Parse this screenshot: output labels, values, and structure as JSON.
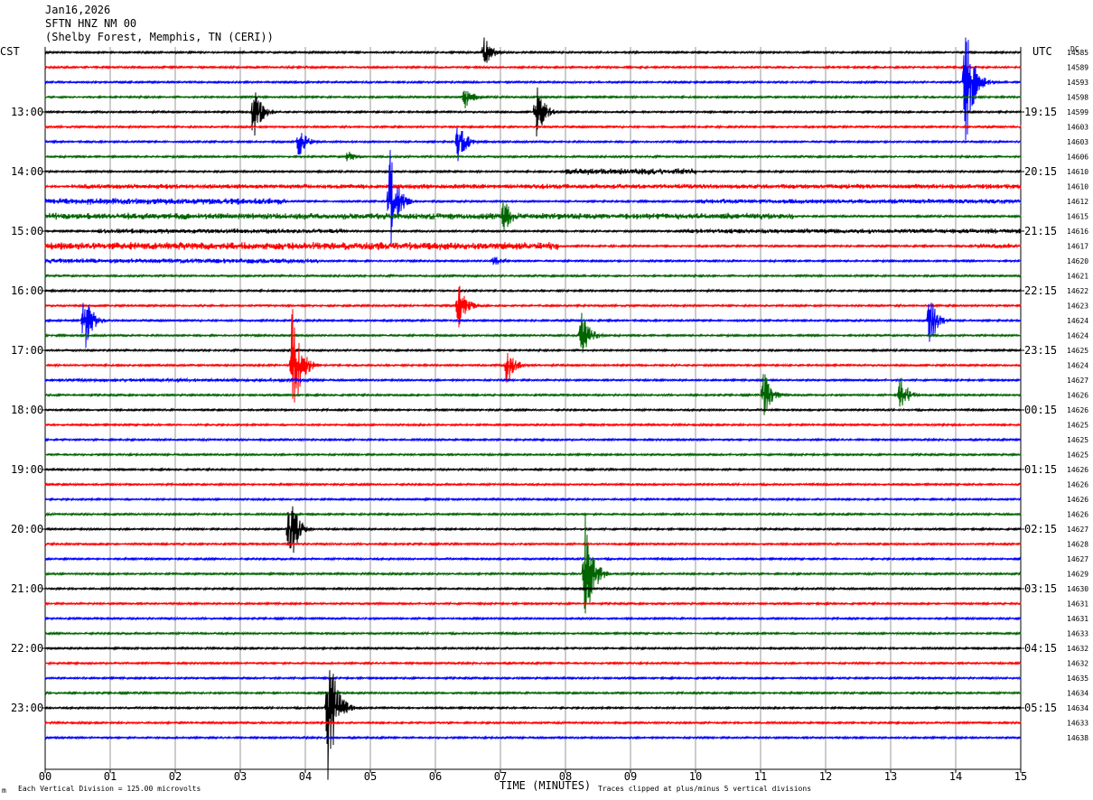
{
  "header": {
    "date": "Jan16,2026",
    "station": "SFTN HNZ NM 00",
    "location": "(Shelby Forest, Memphis, TN (CERI))"
  },
  "left_tz_label": "CST",
  "right_tz_label": "UTC",
  "dc_label": "DC",
  "footer": {
    "scale_note": "Each Vertical Division =  125.00 microvolts",
    "clip_note": "Traces clipped at plus/minus 5 vertical divisions",
    "corner_mark": "m"
  },
  "chart_data": {
    "type": "helicorder",
    "xlabel": "TIME (MINUTES)",
    "xlim": [
      0,
      15
    ],
    "x_ticks": [
      "00",
      "01",
      "02",
      "03",
      "04",
      "05",
      "06",
      "07",
      "08",
      "09",
      "10",
      "11",
      "12",
      "13",
      "14",
      "15"
    ],
    "trace_minutes": 15,
    "trace_colors": [
      "#000000",
      "#ff0000",
      "#0000ff",
      "#006400"
    ],
    "left_hour_labels": [
      {
        "row": 4,
        "text": "13:00"
      },
      {
        "row": 8,
        "text": "14:00"
      },
      {
        "row": 12,
        "text": "15:00"
      },
      {
        "row": 16,
        "text": "16:00"
      },
      {
        "row": 20,
        "text": "17:00"
      },
      {
        "row": 24,
        "text": "18:00"
      },
      {
        "row": 28,
        "text": "19:00"
      },
      {
        "row": 32,
        "text": "20:00"
      },
      {
        "row": 36,
        "text": "21:00"
      },
      {
        "row": 40,
        "text": "22:00"
      },
      {
        "row": 44,
        "text": "23:00"
      }
    ],
    "right_time_labels": [
      {
        "row": 4,
        "text": "19:15"
      },
      {
        "row": 8,
        "text": "20:15"
      },
      {
        "row": 12,
        "text": "21:15"
      },
      {
        "row": 16,
        "text": "22:15"
      },
      {
        "row": 20,
        "text": "23:15"
      },
      {
        "row": 24,
        "text": "00:15"
      },
      {
        "row": 28,
        "text": "01:15"
      },
      {
        "row": 32,
        "text": "02:15"
      },
      {
        "row": 36,
        "text": "03:15"
      },
      {
        "row": 40,
        "text": "04:15"
      },
      {
        "row": 44,
        "text": "05:15"
      }
    ],
    "dc_offsets": [
      "14585",
      "14589",
      "14593",
      "14598",
      "14599",
      "14603",
      "14603",
      "14606",
      "14610",
      "14610",
      "14612",
      "14615",
      "14616",
      "14617",
      "14620",
      "14621",
      "14622",
      "14623",
      "14624",
      "14624",
      "14625",
      "14624",
      "14627",
      "14626",
      "14626",
      "14625",
      "14625",
      "14625",
      "14626",
      "14626",
      "14626",
      "14626",
      "14627",
      "14628",
      "14627",
      "14629",
      "14630",
      "14631",
      "14631",
      "14633",
      "14632",
      "14632",
      "14635",
      "14634",
      "14634",
      "14633",
      "14638"
    ],
    "noise_bursts": [
      {
        "row": 8,
        "from": 8.0,
        "to": 10.0,
        "amp": 4
      },
      {
        "row": 9,
        "from": 0.4,
        "to": 15.0,
        "amp": 3
      },
      {
        "row": 10,
        "from": 0.0,
        "to": 3.7,
        "amp": 4
      },
      {
        "row": 10,
        "from": 10.0,
        "to": 15.0,
        "amp": 3
      },
      {
        "row": 11,
        "from": 0.0,
        "to": 11.5,
        "amp": 4
      },
      {
        "row": 12,
        "from": 0.8,
        "to": 4.6,
        "amp": 3
      },
      {
        "row": 12,
        "from": 9.8,
        "to": 15.0,
        "amp": 3
      },
      {
        "row": 13,
        "from": 0.0,
        "to": 7.9,
        "amp": 5
      },
      {
        "row": 13,
        "from": 14.3,
        "to": 15.0,
        "amp": 3
      },
      {
        "row": 14,
        "from": 0.0,
        "to": 4.2,
        "amp": 3
      },
      {
        "row": 22,
        "from": 0.0,
        "to": 4.2,
        "amp": 2
      }
    ],
    "events": [
      {
        "row": 0,
        "minute": 6.75,
        "amp": 20
      },
      {
        "row": 2,
        "minute": 14.15,
        "amp": 80
      },
      {
        "row": 3,
        "minute": 6.45,
        "amp": 14
      },
      {
        "row": 4,
        "minute": 3.2,
        "amp": 38
      },
      {
        "row": 4,
        "minute": 7.55,
        "amp": 34
      },
      {
        "row": 6,
        "minute": 3.9,
        "amp": 18
      },
      {
        "row": 6,
        "minute": 6.35,
        "amp": 26
      },
      {
        "row": 7,
        "minute": 4.65,
        "amp": 8
      },
      {
        "row": 10,
        "minute": 5.3,
        "amp": 60
      },
      {
        "row": 11,
        "minute": 7.05,
        "amp": 22
      },
      {
        "row": 14,
        "minute": 6.9,
        "amp": 8
      },
      {
        "row": 17,
        "minute": 6.35,
        "amp": 30
      },
      {
        "row": 18,
        "minute": 0.6,
        "amp": 40
      },
      {
        "row": 18,
        "minute": 13.6,
        "amp": 30
      },
      {
        "row": 19,
        "minute": 8.25,
        "amp": 34
      },
      {
        "row": 21,
        "minute": 3.8,
        "amp": 80
      },
      {
        "row": 21,
        "minute": 7.1,
        "amp": 24
      },
      {
        "row": 23,
        "minute": 11.05,
        "amp": 28
      },
      {
        "row": 23,
        "minute": 13.15,
        "amp": 24
      },
      {
        "row": 32,
        "minute": 3.75,
        "amp": 50
      },
      {
        "row": 35,
        "minute": 8.3,
        "amp": 70
      },
      {
        "row": 44,
        "minute": 4.35,
        "amp": 90
      }
    ]
  }
}
